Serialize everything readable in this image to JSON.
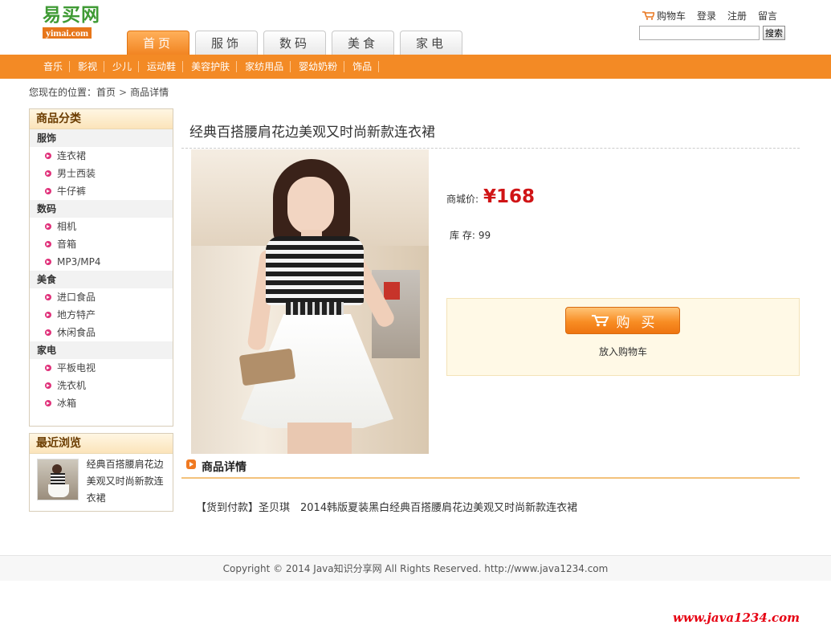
{
  "logo": {
    "cn": "易买网",
    "en": "yimai.com"
  },
  "main_tabs": [
    "首页",
    "服饰",
    "数码",
    "美食",
    "家电"
  ],
  "top_links": {
    "cart": "购物车",
    "login": "登录",
    "register": "注册",
    "message": "留言"
  },
  "search": {
    "placeholder": "",
    "button": "搜索"
  },
  "sub_nav": [
    "音乐",
    "影视",
    "少儿",
    "运动鞋",
    "美容护肤",
    "家纺用品",
    "婴幼奶粉",
    "饰品"
  ],
  "breadcrumb": {
    "prefix": "您现在的位置：",
    "home": "首页",
    "sep": ">",
    "current": "商品详情"
  },
  "sidebar": {
    "category_title": "商品分类",
    "groups": [
      {
        "name": "服饰",
        "items": [
          "连衣裙",
          "男士西装",
          "牛仔裤"
        ]
      },
      {
        "name": "数码",
        "items": [
          "相机",
          "音箱",
          "MP3/MP4"
        ]
      },
      {
        "name": "美食",
        "items": [
          "进口食品",
          "地方特产",
          "休闲食品"
        ]
      },
      {
        "name": "家电",
        "items": [
          "平板电视",
          "洗衣机",
          "冰箱"
        ]
      }
    ],
    "recent_title": "最近浏览",
    "recent_item": "经典百搭腰肩花边美观又时尚新款连衣裙"
  },
  "product": {
    "title": "经典百搭腰肩花边美观又时尚新款连衣裙",
    "price_label": "商城价:",
    "price": "¥168",
    "stock_label": "库 存:",
    "stock": "99",
    "buy_label": "购买",
    "add_cart": "放入购物车"
  },
  "detail": {
    "title": "商品详情",
    "text": "【货到付款】圣贝琪　2014韩版夏装黑白经典百搭腰肩花边美观又时尚新款连衣裙"
  },
  "footer": {
    "copyright": "Copyright © 2014 Java知识分享网 All Rights Reserved. http://www.java1234.com"
  },
  "watermark": "www.java1234.com",
  "colors": {
    "accent": "#f38a25",
    "price": "#d01416",
    "logo_green": "#3f9a34"
  }
}
